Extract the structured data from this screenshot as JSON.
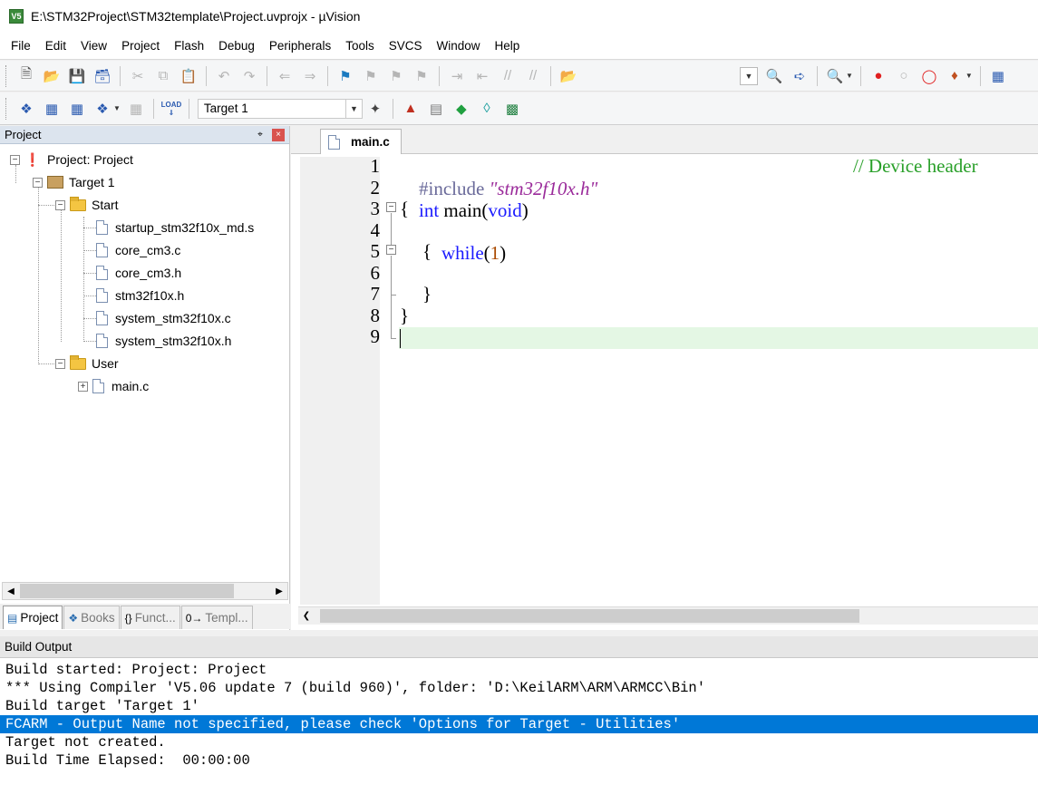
{
  "window": {
    "title": "E:\\STM32Project\\STM32template\\Project.uvprojx - µVision",
    "app_icon_text": "V5"
  },
  "menu": [
    "File",
    "Edit",
    "View",
    "Project",
    "Flash",
    "Debug",
    "Peripherals",
    "Tools",
    "SVCS",
    "Window",
    "Help"
  ],
  "toolbar2": {
    "load_label": "LOAD",
    "target_select": "Target 1"
  },
  "project_panel": {
    "title": "Project",
    "pin": "⌖",
    "close": "×",
    "tree": {
      "root": "Project: Project",
      "target": "Target 1",
      "group_start": "Start",
      "start_files": [
        "startup_stm32f10x_md.s",
        "core_cm3.c",
        "core_cm3.h",
        "stm32f10x.h",
        "system_stm32f10x.c",
        "system_stm32f10x.h"
      ],
      "group_user": "User",
      "user_files": [
        "main.c"
      ]
    },
    "tabs": [
      "Project",
      "Books",
      "Funct...",
      "Templ..."
    ]
  },
  "editor": {
    "tab_label": "main.c",
    "line_numbers": [
      "1",
      "2",
      "3",
      "4",
      "5",
      "6",
      "7",
      "8",
      "9"
    ],
    "code": {
      "l1_include": "#include",
      "l1_string": "\"stm32f10x.h\"",
      "l1_comment": "// Device header",
      "l2_int": "int",
      "l2_main": " main(",
      "l2_void": "void",
      "l2_close": ")",
      "l3": "{",
      "l4_while": "while",
      "l4_open": "(",
      "l4_num": "1",
      "l4_close": ")",
      "l5": "{",
      "l7": "}",
      "l8": "}"
    }
  },
  "build_output": {
    "title": "Build Output",
    "lines": [
      "Build started: Project: Project",
      "*** Using Compiler 'V5.06 update 7 (build 960)', folder: 'D:\\KeilARM\\ARM\\ARMCC\\Bin'",
      "Build target 'Target 1'",
      "FCARM - Output Name not specified, please check 'Options for Target - Utilities'",
      "Target not created.",
      "Build Time Elapsed:  00:00:00"
    ],
    "highlight_color": "#0078d7"
  }
}
